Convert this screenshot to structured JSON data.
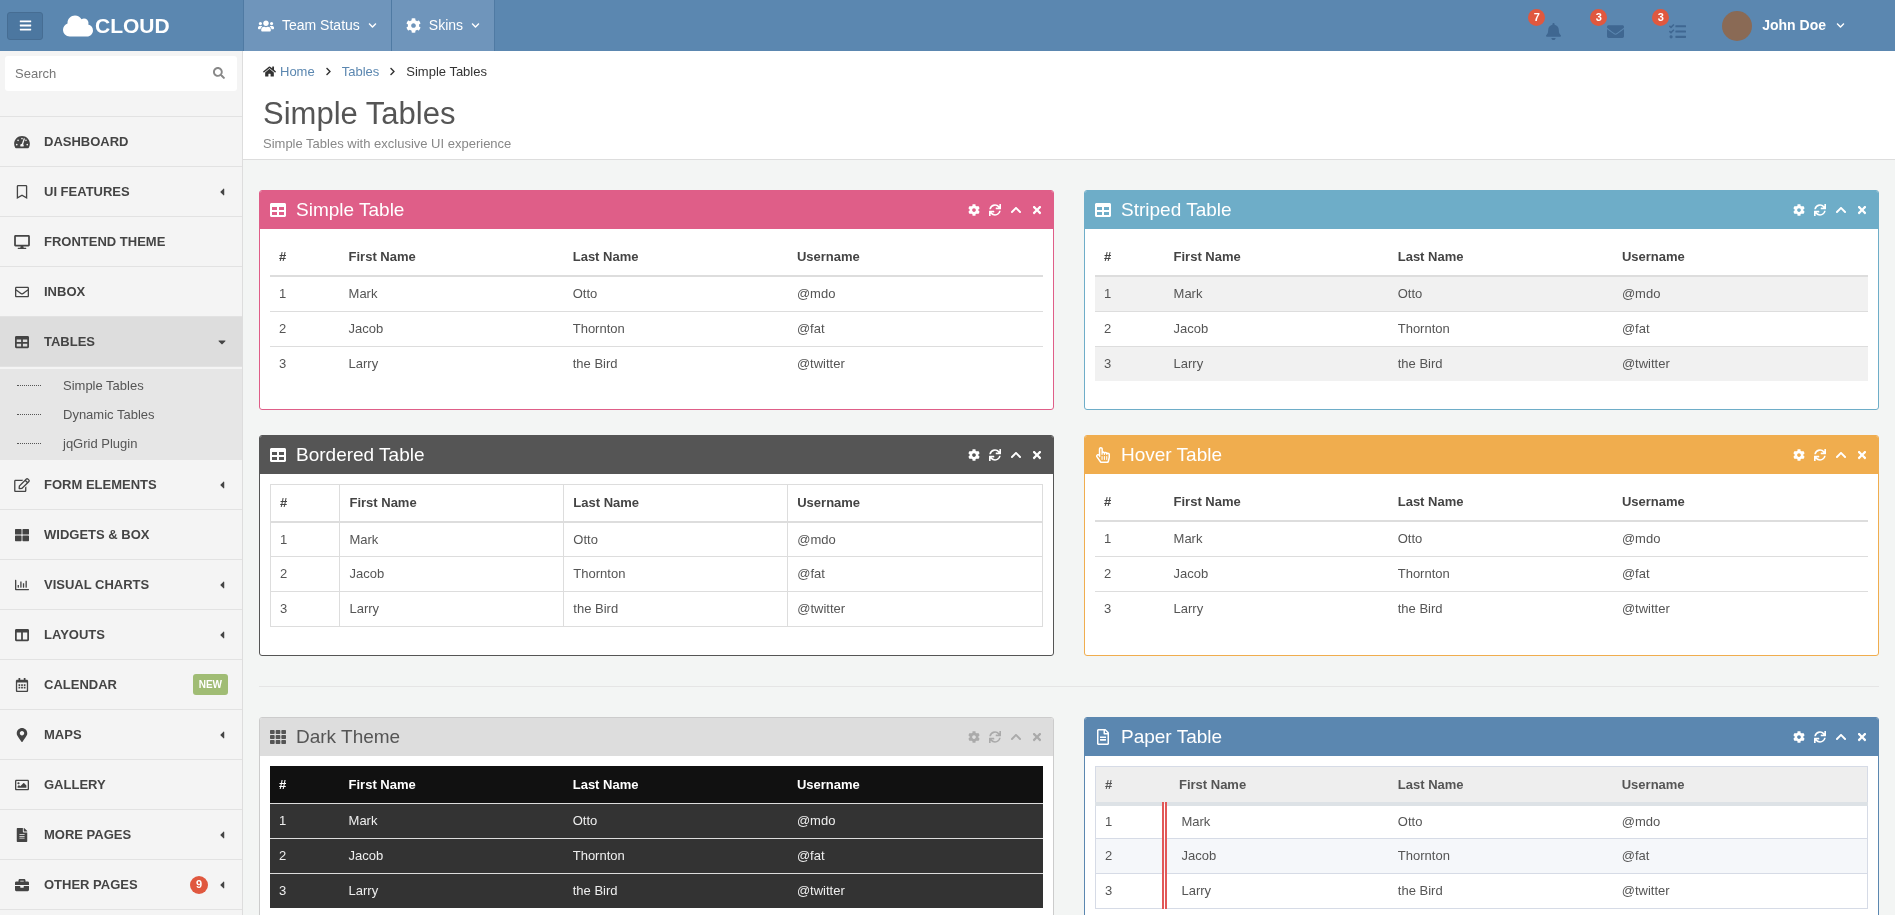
{
  "topbar": {
    "logo": "CLOUD",
    "menus": [
      {
        "label": "Team Status"
      },
      {
        "label": "Skins"
      }
    ],
    "notifications": [
      {
        "count": "7"
      },
      {
        "count": "3"
      },
      {
        "count": "3"
      }
    ],
    "user": {
      "name": "John Doe"
    }
  },
  "sidebar": {
    "search": {
      "placeholder": "Search"
    },
    "items": [
      {
        "label": "DASHBOARD",
        "selected": false
      },
      {
        "label": "UI FEATURES",
        "selected": false,
        "expanded": false
      },
      {
        "label": "FRONTEND THEME",
        "selected": false
      },
      {
        "label": "INBOX",
        "selected": false
      },
      {
        "label": "TABLES",
        "selected": true,
        "expanded": true,
        "children": [
          {
            "label": "Simple Tables"
          },
          {
            "label": "Dynamic Tables"
          },
          {
            "label": "jqGrid Plugin"
          }
        ]
      },
      {
        "label": "FORM ELEMENTS",
        "selected": false,
        "expanded": false
      },
      {
        "label": "WIDGETS & BOX",
        "selected": false
      },
      {
        "label": "VISUAL CHARTS",
        "selected": false,
        "expanded": false
      },
      {
        "label": "LAYOUTS",
        "selected": false,
        "expanded": false
      },
      {
        "label": "CALENDAR",
        "selected": false,
        "badge": {
          "kind": "label",
          "text": "NEW"
        }
      },
      {
        "label": "MAPS",
        "selected": false,
        "expanded": false
      },
      {
        "label": "GALLERY",
        "selected": false
      },
      {
        "label": "MORE PAGES",
        "selected": false,
        "expanded": false
      },
      {
        "label": "OTHER PAGES",
        "selected": false,
        "expanded": false,
        "badge": {
          "kind": "count",
          "text": "9"
        }
      }
    ]
  },
  "breadcrumb": [
    {
      "label": "Home"
    },
    {
      "label": "Tables"
    },
    {
      "label": "Simple Tables"
    }
  ],
  "page": {
    "title": "Simple Tables",
    "subtitle": "Simple Tables with exclusive UI experience"
  },
  "panels": [
    {
      "kind": "simple",
      "title": "Simple Table",
      "columns": [
        "#",
        "First Name",
        "Last Name",
        "Username"
      ],
      "rows": [
        [
          "1",
          "Mark",
          "Otto",
          "@mdo"
        ],
        [
          "2",
          "Jacob",
          "Thornton",
          "@fat"
        ],
        [
          "3",
          "Larry",
          "the Bird",
          "@twitter"
        ]
      ]
    },
    {
      "kind": "striped",
      "title": "Striped Table",
      "columns": [
        "#",
        "First Name",
        "Last Name",
        "Username"
      ],
      "rows": [
        [
          "1",
          "Mark",
          "Otto",
          "@mdo"
        ],
        [
          "2",
          "Jacob",
          "Thornton",
          "@fat"
        ],
        [
          "3",
          "Larry",
          "the Bird",
          "@twitter"
        ]
      ]
    },
    {
      "kind": "bordered",
      "title": "Bordered Table",
      "columns": [
        "#",
        "First Name",
        "Last Name",
        "Username"
      ],
      "rows": [
        [
          "1",
          "Mark",
          "Otto",
          "@mdo"
        ],
        [
          "2",
          "Jacob",
          "Thornton",
          "@fat"
        ],
        [
          "3",
          "Larry",
          "the Bird",
          "@twitter"
        ]
      ]
    },
    {
      "kind": "hover",
      "title": "Hover Table",
      "columns": [
        "#",
        "First Name",
        "Last Name",
        "Username"
      ],
      "rows": [
        [
          "1",
          "Mark",
          "Otto",
          "@mdo"
        ],
        [
          "2",
          "Jacob",
          "Thornton",
          "@fat"
        ],
        [
          "3",
          "Larry",
          "the Bird",
          "@twitter"
        ]
      ]
    },
    {
      "kind": "dark",
      "title": "Dark Theme",
      "columns": [
        "#",
        "First Name",
        "Last Name",
        "Username"
      ],
      "rows": [
        [
          "1",
          "Mark",
          "Otto",
          "@mdo"
        ],
        [
          "2",
          "Jacob",
          "Thornton",
          "@fat"
        ],
        [
          "3",
          "Larry",
          "the Bird",
          "@twitter"
        ]
      ]
    },
    {
      "kind": "paper",
      "title": "Paper Table",
      "columns": [
        "#",
        "First Name",
        "Last Name",
        "Username"
      ],
      "rows": [
        [
          "1",
          "Mark",
          "Otto",
          "@mdo"
        ],
        [
          "2",
          "Jacob",
          "Thornton",
          "@fat"
        ],
        [
          "3",
          "Larry",
          "the Bird",
          "@twitter"
        ]
      ]
    }
  ]
}
